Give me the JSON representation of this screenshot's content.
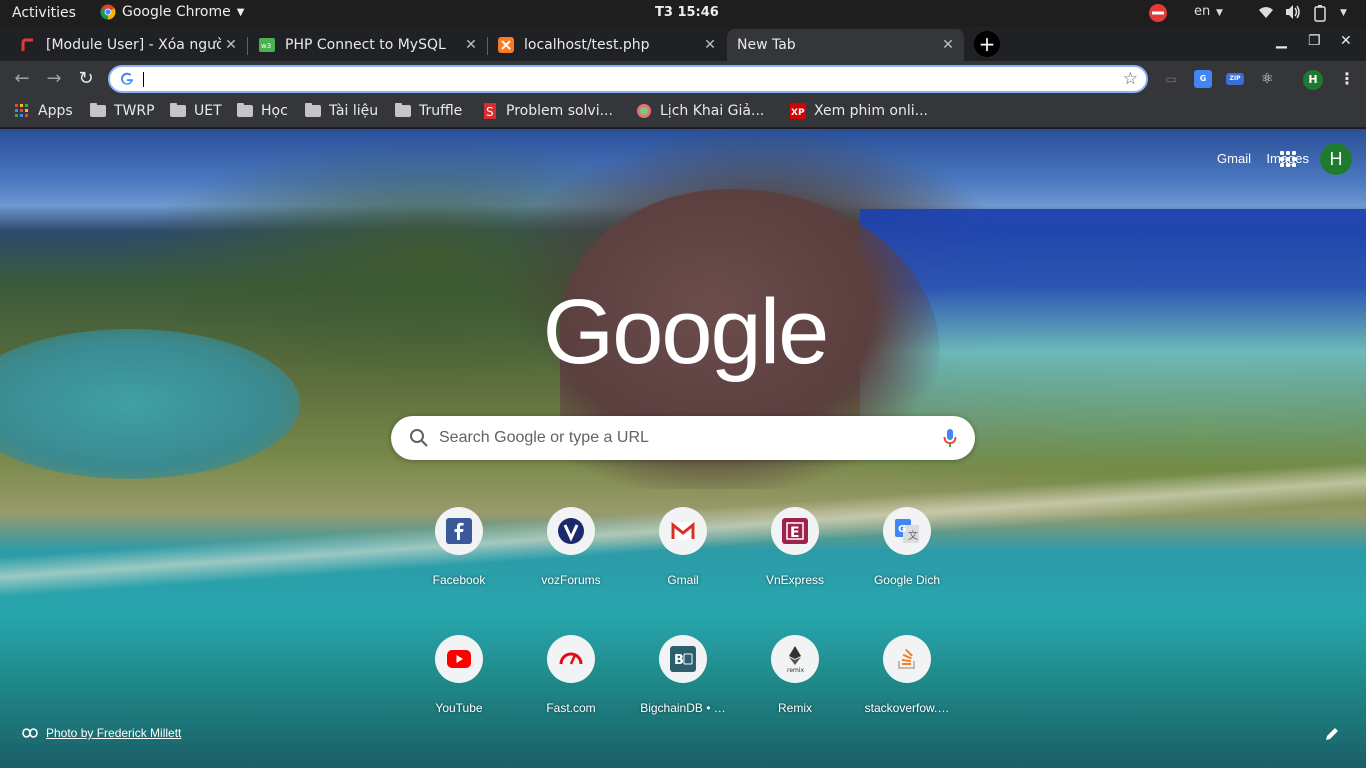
{
  "topbar": {
    "activities": "Activities",
    "app_name": "Google Chrome",
    "clock": "T3 15:46",
    "lang": "en"
  },
  "tabs": [
    {
      "title": "[Module User] - Xóa người",
      "favicon": "red-arrow-icon",
      "active": false
    },
    {
      "title": "PHP Connect to MySQL",
      "favicon": "w3schools-icon",
      "active": false
    },
    {
      "title": "localhost/test.php",
      "favicon": "xampp-icon",
      "active": false
    },
    {
      "title": "New Tab",
      "favicon": "",
      "active": true
    }
  ],
  "omnibox": {
    "value": "",
    "placeholder": ""
  },
  "profile_initial": "H",
  "bookmarks": [
    {
      "label": "Apps",
      "icon": "apps-grid-icon"
    },
    {
      "label": "TWRP",
      "icon": "folder-icon"
    },
    {
      "label": "UET",
      "icon": "folder-icon"
    },
    {
      "label": "Học",
      "icon": "folder-icon"
    },
    {
      "label": "Tài liệu",
      "icon": "folder-icon"
    },
    {
      "label": "Truffle",
      "icon": "folder-icon"
    },
    {
      "label": "Problem solvi...",
      "icon": "problem-solving-icon"
    },
    {
      "label": "Lịch Khai Giả...",
      "icon": "globe-icon"
    },
    {
      "label": "Xem phim onli...",
      "icon": "xp-icon"
    }
  ],
  "ntp": {
    "gmail": "Gmail",
    "images": "Images",
    "logo": "Google",
    "search_placeholder": "Search Google or type a URL",
    "photo_credit": "Photo by Frederick Millett",
    "shortcuts": [
      {
        "label": "Facebook",
        "icon": "facebook-icon",
        "color": "#3b5998"
      },
      {
        "label": "vozForums",
        "icon": "voz-icon",
        "color": "#1b2a6b"
      },
      {
        "label": "Gmail",
        "icon": "gmail-icon",
        "color": "#d93025"
      },
      {
        "label": "VnExpress",
        "icon": "vnexpress-icon",
        "color": "#9f224e"
      },
      {
        "label": "Google Dich",
        "icon": "google-translate-icon",
        "color": "#4285f4"
      },
      {
        "label": "YouTube",
        "icon": "youtube-icon",
        "color": "#ff0000"
      },
      {
        "label": "Fast.com",
        "icon": "fast-com-icon",
        "color": "#e50914"
      },
      {
        "label": "BigchainDB • …",
        "icon": "bigchaindb-icon",
        "color": "#2c5f6e"
      },
      {
        "label": "Remix",
        "icon": "remix-icon",
        "color": "#333333"
      },
      {
        "label": "stackoverfow.…",
        "icon": "stackoverflow-icon",
        "color": "#f48024"
      }
    ]
  }
}
